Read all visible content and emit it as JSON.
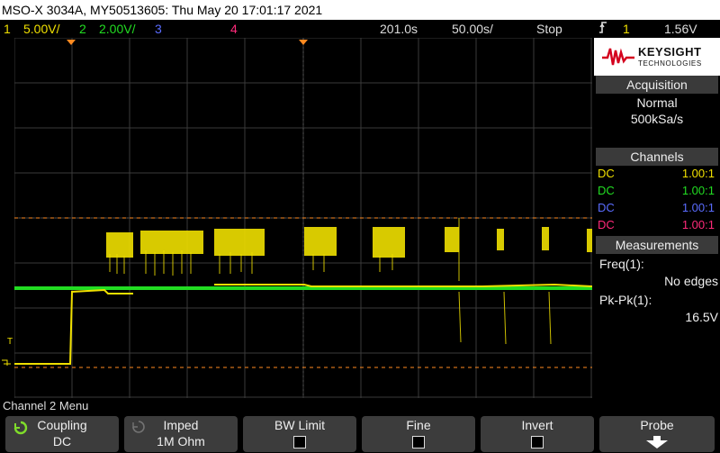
{
  "title": "MSO-X 3034A, MY50513605: Thu May 20 17:01:17 2021",
  "status": {
    "ch1_num": "1",
    "ch1_scale": "5.00V/",
    "ch2_num": "2",
    "ch2_scale": "2.00V/",
    "ch3_num": "3",
    "ch4_num": "4",
    "time_offset": "201.0s",
    "time_scale": "50.00s/",
    "run_state": "Stop",
    "trigger_channel": "1",
    "trigger_level": "1.56V"
  },
  "brand": {
    "word1": "KEYSIGHT",
    "word2": "TECHNOLOGIES"
  },
  "acquisition": {
    "header": "Acquisition",
    "mode": "Normal",
    "rate": "500kSa/s"
  },
  "channels": {
    "header": "Channels",
    "rows": [
      {
        "coupling": "DC",
        "ratio": "1.00:1",
        "color": "#f0e000"
      },
      {
        "coupling": "DC",
        "ratio": "1.00:1",
        "color": "#22dd22"
      },
      {
        "coupling": "DC",
        "ratio": "1.00:1",
        "color": "#5a6cff"
      },
      {
        "coupling": "DC",
        "ratio": "1.00:1",
        "color": "#ff2a7a"
      }
    ]
  },
  "measurements": {
    "header": "Measurements",
    "freq_label": "Freq(1):",
    "freq_value": "No edges",
    "pkpk_label": "Pk-Pk(1):",
    "pkpk_value": "16.5V"
  },
  "menu_title": "Channel 2 Menu",
  "softkeys": {
    "coupling_label": "Coupling",
    "coupling_value": "DC",
    "imped_label": "Imped",
    "imped_value": "1M Ohm",
    "bw_label": "BW Limit",
    "fine_label": "Fine",
    "invert_label": "Invert",
    "probe_label": "Probe"
  },
  "colors": {
    "ch1": "#f0e000",
    "ch2": "#22dd22",
    "ch3": "#5a6cff",
    "ch4": "#ff2a7a",
    "orange": "#ff8a20"
  },
  "icons": [
    "rotate-knob-icon",
    "trigger-edge-icon",
    "down-arrow-icon"
  ]
}
